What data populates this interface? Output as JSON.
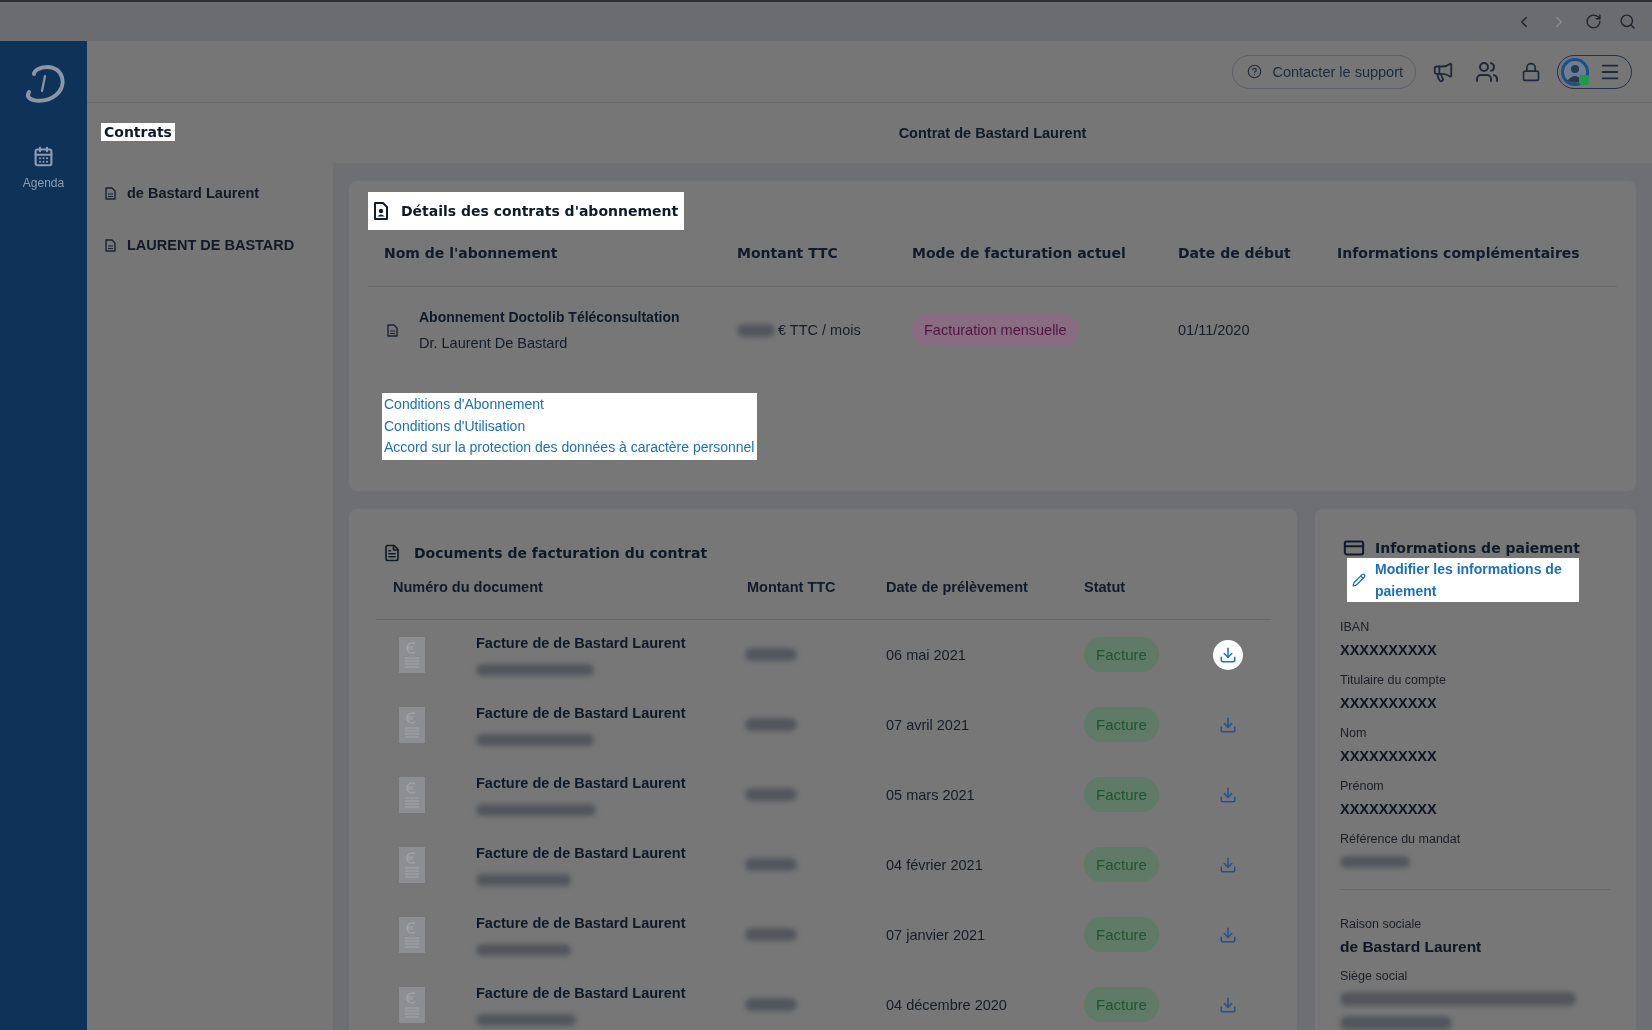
{
  "browser_toolbar": {
    "back": {
      "disabled": false
    },
    "forward": {
      "disabled": true
    }
  },
  "nav_rail": {
    "items": [
      {
        "label": "Agenda",
        "selected": false
      }
    ]
  },
  "header": {
    "support_button": "Contacter le support",
    "avatar": {
      "online": true
    }
  },
  "contracts_panel": {
    "title": "Contrats",
    "title_highlighted": true,
    "items": [
      {
        "label": "de Bastard Laurent"
      },
      {
        "label": "LAURENT DE BASTARD"
      }
    ]
  },
  "page_title": "Contrat de Bastard Laurent",
  "subscription_details": {
    "title": "Détails des contrats d'abonnement",
    "title_highlighted": true,
    "columns": [
      "Nom de l'abonnement",
      "Montant TTC",
      "Mode de facturation actuel",
      "Date de début",
      "Informations complémentaires"
    ],
    "rows": [
      {
        "name": "Abonnement Doctolib Téléconsultation",
        "holder": "Dr. Laurent De Bastard",
        "amount_unit": "€ TTC / mois",
        "billing_mode": "Facturation mensuelle",
        "start_date": "01/11/2020"
      }
    ],
    "links": {
      "highlighted": true,
      "items": [
        "Conditions d'Abonnement",
        "Conditions d'Utilisation",
        "Accord sur la protection des données à caractère personnel"
      ]
    }
  },
  "billing_documents": {
    "title": "Documents de facturation du contrat",
    "columns": [
      "Numéro du document",
      "Montant TTC",
      "Date de prélèvement",
      "Statut"
    ],
    "rows": [
      {
        "title": "Facture de de Bastard Laurent",
        "date": "06 mai 2021",
        "status": "Facture",
        "download_highlighted": true
      },
      {
        "title": "Facture de de Bastard Laurent",
        "date": "07 avril 2021",
        "status": "Facture",
        "download_highlighted": false
      },
      {
        "title": "Facture de de Bastard Laurent",
        "date": "05 mars 2021",
        "status": "Facture",
        "download_highlighted": false
      },
      {
        "title": "Facture de de Bastard Laurent",
        "date": "04 février 2021",
        "status": "Facture",
        "download_highlighted": false
      },
      {
        "title": "Facture de de Bastard Laurent",
        "date": "07 janvier 2021",
        "status": "Facture",
        "download_highlighted": false
      },
      {
        "title": "Facture de de Bastard Laurent",
        "date": "04 décembre 2020",
        "status": "Facture",
        "download_highlighted": false
      }
    ]
  },
  "payment_info": {
    "title": "Informations de paiement",
    "edit_link": {
      "label": "Modifier les informations de paiement",
      "highlighted": true
    },
    "fields": [
      {
        "kind": "text",
        "label": "IBAN",
        "value": "XXXXXXXXXX"
      },
      {
        "kind": "text",
        "label": "Titulaire du compte",
        "value": "XXXXXXXXXX"
      },
      {
        "kind": "text",
        "label": "Nom",
        "value": "XXXXXXXXXX"
      },
      {
        "kind": "text",
        "label": "Prénom",
        "value": "XXXXXXXXXX"
      },
      {
        "kind": "redacted",
        "label": "Référence du mandat"
      }
    ],
    "company_fields": [
      {
        "kind": "text",
        "label": "Raison sociale",
        "value": "de Bastard Laurent"
      },
      {
        "kind": "redacted_multiline",
        "label": "Siège social"
      }
    ]
  }
}
